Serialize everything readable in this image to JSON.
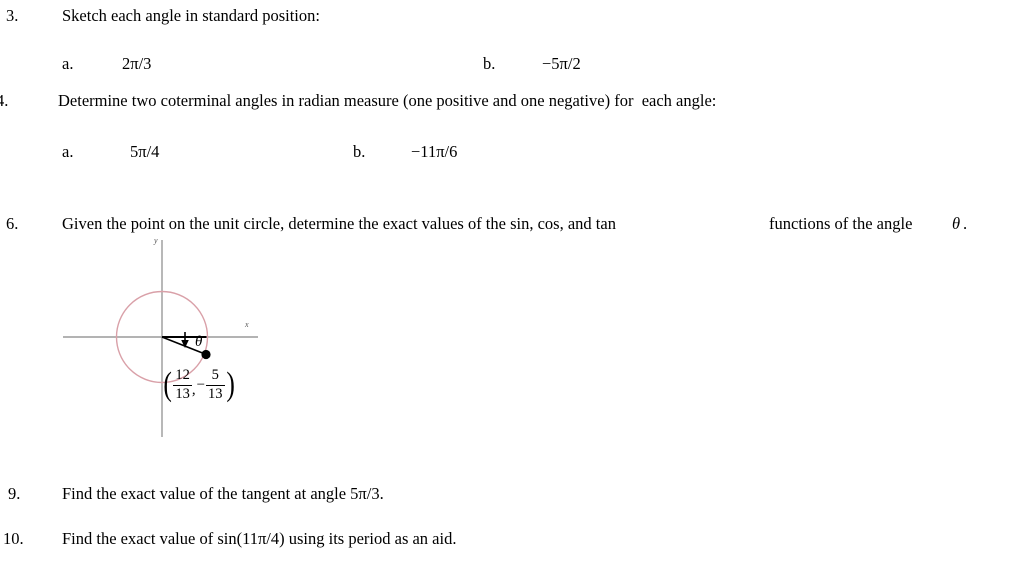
{
  "document": {
    "type": "math-worksheet",
    "topic": "Angles in standard position, coterminal angles, unit circle trigonometric values"
  },
  "items": [
    {
      "number": "3.",
      "prompt": "Sketch each angle in standard position:",
      "parts": [
        {
          "label": "a.",
          "value": "2π/3"
        },
        {
          "label": "b.",
          "value": "−5π/2"
        }
      ]
    },
    {
      "number": "4.",
      "prompt": "Determine two coterminal angles in radian measure (one positive and one negative) for  each angle:",
      "parts": [
        {
          "label": "a.",
          "value": "5π/4"
        },
        {
          "label": "b.",
          "value": "−11π/6"
        }
      ]
    },
    {
      "number": "6.",
      "prompt_left": "Given the point on the unit circle, determine the exact values of the sin, cos, and tan",
      "prompt_right": "functions of the angle",
      "prompt_symbol": "θ",
      "prompt_end": "."
    },
    {
      "number": "9.",
      "prompt": "Find the exact value of the tangent at angle 5π/3."
    },
    {
      "number": "10.",
      "prompt": "Find the exact value of sin(11π/4) using its period as an aid."
    }
  ],
  "figure": {
    "name": "unit-circle-diagram",
    "axis_label_x": "x",
    "axis_label_y": "y",
    "angle_symbol": "θ",
    "point": {
      "x_numerator": "12",
      "x_denominator": "13",
      "y_sign": "−",
      "y_numerator": "5",
      "y_denominator": "13",
      "open_paren": "(",
      "close_paren": ")",
      "separator": ","
    },
    "colors": {
      "circle_stroke": "#d9a0a8",
      "axis_stroke": "#9a9a9a",
      "ray_stroke": "#000000",
      "point_fill": "#000000"
    }
  }
}
